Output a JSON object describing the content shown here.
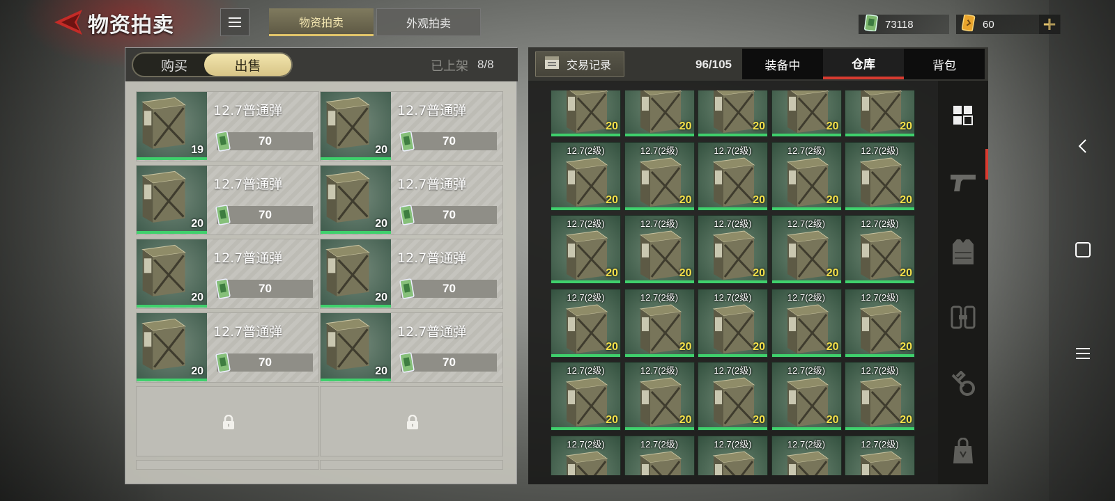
{
  "header": {
    "title": "物资拍卖",
    "tabs": [
      {
        "label": "物资拍卖",
        "active": true
      },
      {
        "label": "外观拍卖",
        "active": false
      }
    ],
    "currency": {
      "money": "73118",
      "tickets": "60"
    },
    "accent_color": "#e2c56a"
  },
  "sell_panel": {
    "toggle": {
      "buy": "购买",
      "sell": "出售",
      "selected": "出售"
    },
    "listed_label": "已上架",
    "listed_value": "8/8",
    "listings": [
      {
        "name": "12.7普通弹",
        "qty": "19",
        "price": "70"
      },
      {
        "name": "12.7普通弹",
        "qty": "20",
        "price": "70"
      },
      {
        "name": "12.7普通弹",
        "qty": "20",
        "price": "70"
      },
      {
        "name": "12.7普通弹",
        "qty": "20",
        "price": "70"
      },
      {
        "name": "12.7普通弹",
        "qty": "20",
        "price": "70"
      },
      {
        "name": "12.7普通弹",
        "qty": "20",
        "price": "70"
      },
      {
        "name": "12.7普通弹",
        "qty": "20",
        "price": "70"
      },
      {
        "name": "12.7普通弹",
        "qty": "20",
        "price": "70"
      }
    ]
  },
  "inventory": {
    "trade_record": "交易记录",
    "capacity": "96/105",
    "tabs": [
      {
        "label": "装备中",
        "active": false
      },
      {
        "label": "仓库",
        "active": true
      },
      {
        "label": "背包",
        "active": false
      }
    ],
    "items": [
      {
        "label": "",
        "count": "20"
      },
      {
        "label": "",
        "count": "20"
      },
      {
        "label": "",
        "count": "20"
      },
      {
        "label": "",
        "count": "20"
      },
      {
        "label": "",
        "count": "20"
      },
      {
        "label": "12.7(2级)",
        "count": "20"
      },
      {
        "label": "12.7(2级)",
        "count": "20"
      },
      {
        "label": "12.7(2级)",
        "count": "20"
      },
      {
        "label": "12.7(2级)",
        "count": "20"
      },
      {
        "label": "12.7(2级)",
        "count": "20"
      },
      {
        "label": "12.7(2级)",
        "count": "20"
      },
      {
        "label": "12.7(2级)",
        "count": "20"
      },
      {
        "label": "12.7(2级)",
        "count": "20"
      },
      {
        "label": "12.7(2级)",
        "count": "20"
      },
      {
        "label": "12.7(2级)",
        "count": "20"
      },
      {
        "label": "12.7(2级)",
        "count": "20"
      },
      {
        "label": "12.7(2级)",
        "count": "20"
      },
      {
        "label": "12.7(2级)",
        "count": "20"
      },
      {
        "label": "12.7(2级)",
        "count": "20"
      },
      {
        "label": "12.7(2级)",
        "count": "20"
      },
      {
        "label": "12.7(2级)",
        "count": "20"
      },
      {
        "label": "12.7(2级)",
        "count": "20"
      },
      {
        "label": "12.7(2级)",
        "count": "20"
      },
      {
        "label": "12.7(2级)",
        "count": "20"
      },
      {
        "label": "12.7(2级)",
        "count": "20"
      },
      {
        "label": "12.7(2级)",
        "count": ""
      },
      {
        "label": "12.7(2级)",
        "count": ""
      },
      {
        "label": "12.7(2级)",
        "count": ""
      },
      {
        "label": "12.7(2级)",
        "count": ""
      },
      {
        "label": "12.7(2级)",
        "count": ""
      }
    ],
    "categories": [
      "grid-icon",
      "pistol-icon",
      "vest-icon",
      "ammo-clip-icon",
      "wrench-gear-icon",
      "bag-icon"
    ]
  },
  "system_nav": [
    "back-arrow-icon",
    "home-square-icon",
    "menu-lines-icon"
  ]
}
